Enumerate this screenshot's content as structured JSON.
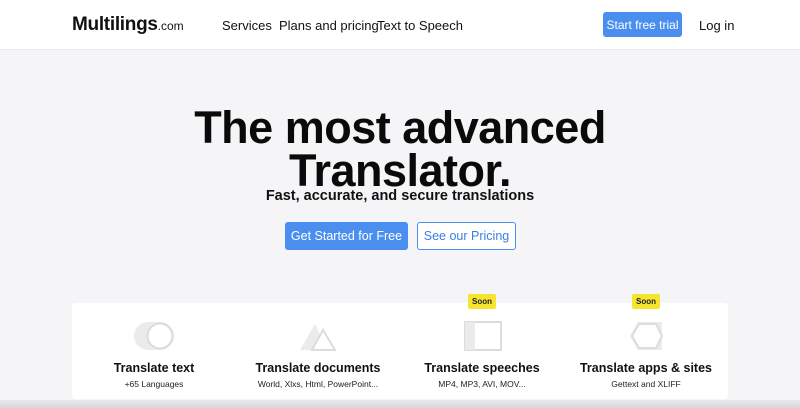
{
  "nav": {
    "logo": {
      "name": "Multilings",
      "tld": ".com"
    },
    "links": [
      "Services",
      "Plans and pricing",
      "Text to Speech"
    ],
    "cta": "Start free trial",
    "login": "Log in"
  },
  "hero": {
    "title_line1": "The most advanced",
    "title_line2": "Translator.",
    "subtitle": "Fast, accurate, and secure translations",
    "primary_button": "Get Started for Free",
    "secondary_button": "See our Pricing"
  },
  "features": [
    {
      "title": "Translate text",
      "subtitle": "+65 Languages",
      "badge": "",
      "icon": "toggle-icon"
    },
    {
      "title": "Translate documents",
      "subtitle": "World, Xlxs, Html, PowerPoint...",
      "badge": "",
      "icon": "triangles-icon"
    },
    {
      "title": "Translate speeches",
      "subtitle": "MP4, MP3, AVI, MOV...",
      "badge": "Soon",
      "icon": "square-icon"
    },
    {
      "title": "Translate apps & sites",
      "subtitle": "Gettext and XLIFF",
      "badge": "Soon",
      "icon": "hexagon-icon"
    }
  ],
  "colors": {
    "accent": "#4a8ff0",
    "badge": "#f5e52e",
    "background": "#f5f5f7"
  }
}
